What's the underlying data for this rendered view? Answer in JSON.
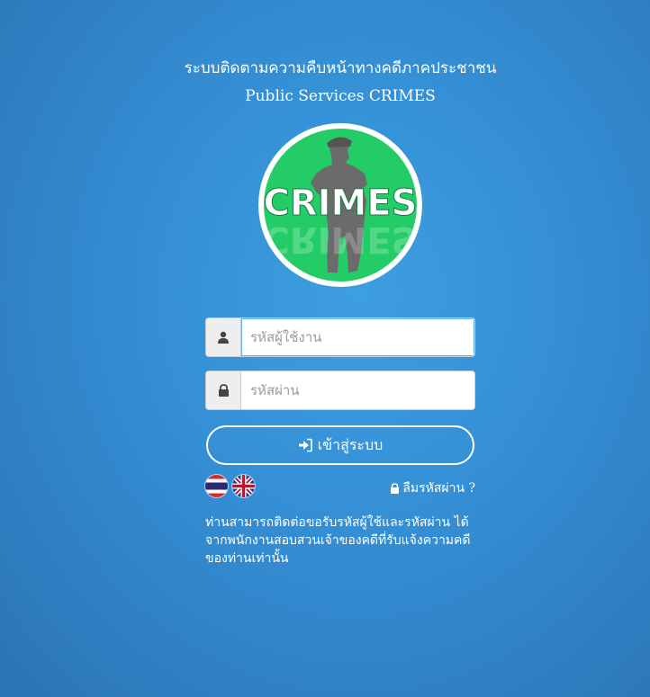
{
  "header": {
    "title_th": "ระบบติดตามความคืบหน้าทางคดีภาคประชาชน",
    "title_en": "Public Services CRIMES"
  },
  "logo": {
    "text": "CRIMES",
    "colors": {
      "ring": "#ffffff",
      "background": "#24cc67",
      "silhouette": "#6b6b6b"
    }
  },
  "login_form": {
    "username": {
      "placeholder": "รหัสผู้ใช้งาน",
      "value": "",
      "icon": "user-icon"
    },
    "password": {
      "placeholder": "รหัสผ่าน",
      "value": "",
      "icon": "lock-icon"
    },
    "submit_label": "เข้าสู่ระบบ",
    "submit_icon": "sign-in-icon"
  },
  "languages": [
    {
      "code": "th",
      "icon": "thai-flag-icon"
    },
    {
      "code": "en",
      "icon": "uk-flag-icon"
    }
  ],
  "forgot_password": {
    "label": "ลืมรหัสผ่าน ?",
    "icon": "lock-icon"
  },
  "note": "ท่านสามารถติดต่อขอรับรหัสผู้ใช้และรหัสผ่าน ได้จากพนักงานสอบสวนเจ้าของคดีที่รับแจ้งความคดีของท่านเท่านั้น",
  "theme": {
    "background": "#3590d6",
    "accent": "#66afe9"
  }
}
